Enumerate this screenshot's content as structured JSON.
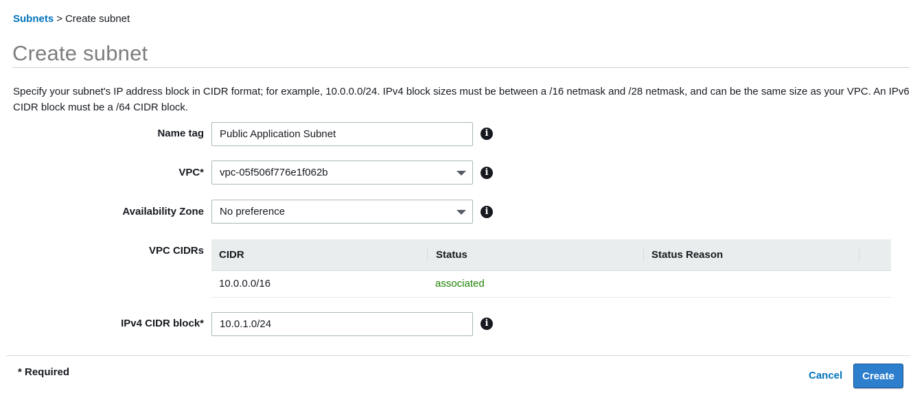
{
  "breadcrumb": {
    "parent": "Subnets",
    "separator": ">",
    "current": "Create subnet"
  },
  "page_title": "Create subnet",
  "description": "Specify your subnet's IP address block in CIDR format; for example, 10.0.0.0/24. IPv4 block sizes must be between a /16 netmask and /28 netmask, and can be the same size as your VPC. An IPv6 CIDR block must be a /64 CIDR block.",
  "form": {
    "name_tag": {
      "label": "Name tag",
      "value": "Public Application Subnet"
    },
    "vpc": {
      "label": "VPC*",
      "value": "vpc-05f506f776e1f062b"
    },
    "availability_zone": {
      "label": "Availability Zone",
      "value": "No preference"
    },
    "vpc_cidrs": {
      "label": "VPC CIDRs",
      "columns": [
        "CIDR",
        "Status",
        "Status Reason"
      ],
      "rows": [
        {
          "cidr": "10.0.0.0/16",
          "status": "associated",
          "status_reason": ""
        }
      ]
    },
    "ipv4_cidr": {
      "label": "IPv4 CIDR block*",
      "value": "10.0.1.0/24"
    },
    "info_icon_glyph": "i"
  },
  "footer": {
    "required_note": "* Required",
    "cancel_label": "Cancel",
    "create_label": "Create"
  },
  "colors": {
    "link": "#0073bb",
    "primary_button": "#2d7fcd",
    "status_ok": "#1d8102",
    "title": "#7d7d7d"
  }
}
